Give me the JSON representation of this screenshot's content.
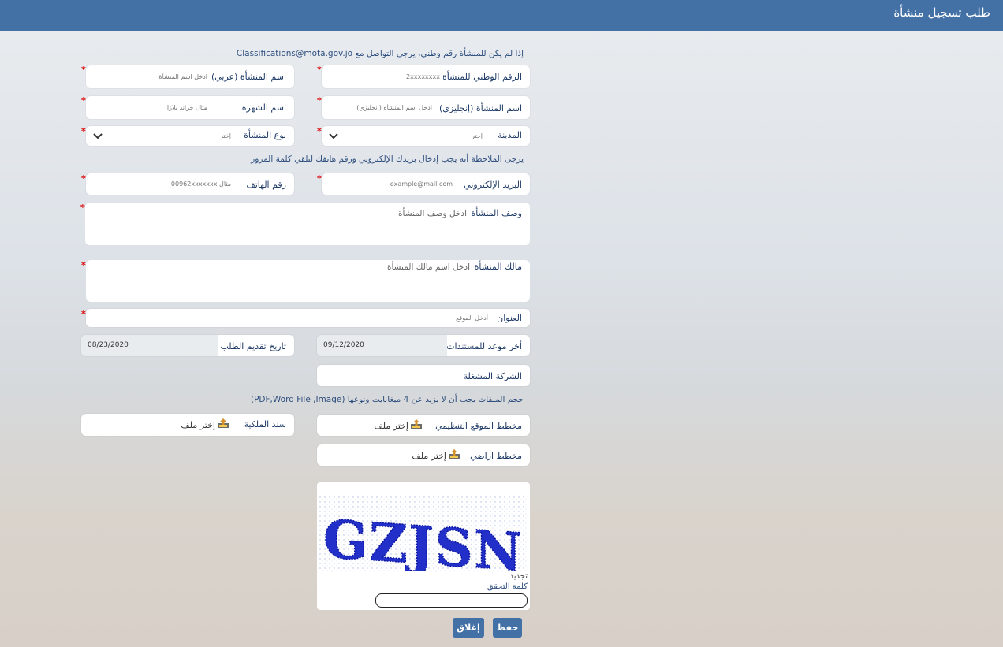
{
  "header": {
    "title": "طلب تسجيل منشأة"
  },
  "notes": {
    "national_number": "إذا لم يكن للمنشأة رقم وطني، يرجى التواصل مع Classifications@mota.gov.jo",
    "contact": "يرجى الملاحظة أنه يجب إدخال بريدك الإلكتروني ورقم هاتفك لتلقي كلمة المرور",
    "files": "حجم الملفات يجب أن لا يزيد عن 4 ميغابايت ونوعها (PDF,Word File ,Image)"
  },
  "fields": {
    "national_number": {
      "label": "الرقم الوطني للمنشأة",
      "placeholder": "2xxxxxxxx"
    },
    "name_ar": {
      "label": "اسم المنشأة (عربي)",
      "placeholder": "ادخل اسم المنشأة"
    },
    "name_en": {
      "label": "اسم المنشأة (إنجليزي)",
      "placeholder": "ادخل اسم المنشأة (إنجليزي)"
    },
    "brand_name": {
      "label": "اسم الشهرة",
      "placeholder": "مثال جراند بلازا"
    },
    "city": {
      "label": "المدينة",
      "value": "إختر"
    },
    "facility_type": {
      "label": "نوع المنشأة",
      "value": "إختر"
    },
    "email": {
      "label": "البريد الإلكتروني",
      "placeholder": "example@mail.com"
    },
    "phone": {
      "label": "رقم الهاتف",
      "placeholder": "مثال 00962xxxxxxx"
    },
    "description": {
      "label": "وصف المنشأة",
      "placeholder": "ادخل وصف المنشأة"
    },
    "owner": {
      "label": "مالك المنشأة",
      "placeholder": "ادخل اسم مالك المنشأة"
    },
    "address": {
      "label": "العنوان",
      "placeholder": "أدخل الموقع"
    },
    "deadline": {
      "label": "أخر موعد للمستندات",
      "value": "09/12/2020"
    },
    "submission_date": {
      "label": "تاريخ تقديم الطلب",
      "value": "08/23/2020"
    },
    "operator": {
      "label": "الشركة المشغلة"
    }
  },
  "files": {
    "site_plan": {
      "label": "مخطط الموقع التنظيمي",
      "choose": "إختر ملف"
    },
    "ownership_deed": {
      "label": "سند الملكية",
      "choose": "إختر ملف"
    },
    "land_plan": {
      "label": "مخطط اراضي",
      "choose": "إختر ملف"
    }
  },
  "captcha": {
    "text": "GZJSN",
    "refresh": "تجديد",
    "label": "كلمة التحقق"
  },
  "buttons": {
    "save": "حفظ",
    "close": "إغلاق"
  },
  "colors": {
    "header": "#4371a6",
    "button": "#4371a6",
    "required": "#dd0000"
  }
}
